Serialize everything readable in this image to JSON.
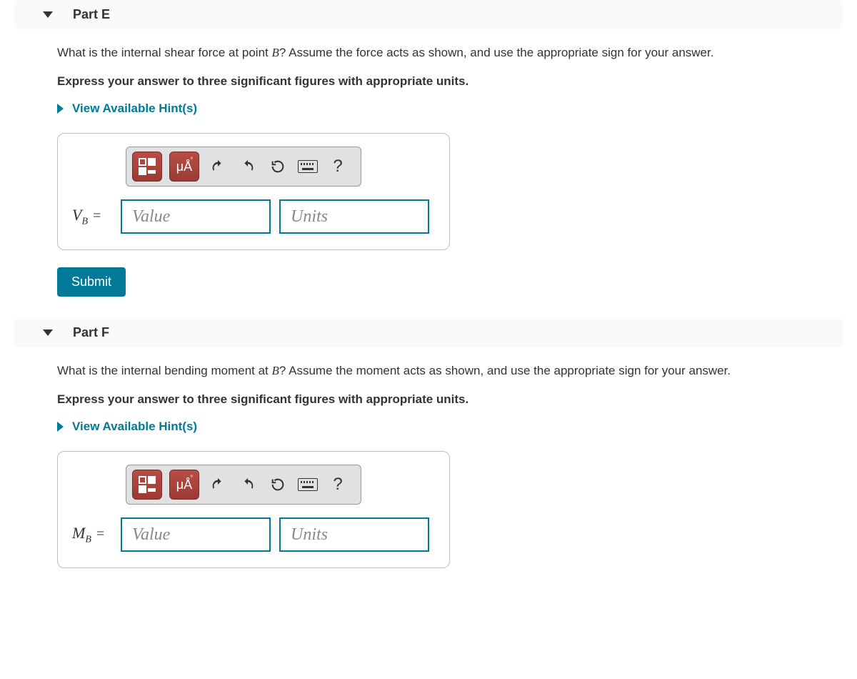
{
  "partE": {
    "title": "Part E",
    "prompt_before": "What is the internal shear force at point ",
    "prompt_var": "B",
    "prompt_after": "? Assume the force acts as shown, and use the appropriate sign for your answer.",
    "instruction": "Express your answer to three significant figures with appropriate units.",
    "hints_label": "View Available Hint(s)",
    "toolbar": {
      "special": "μÅ",
      "help": "?"
    },
    "var_symbol": "V",
    "var_sub": "B",
    "value_placeholder": "Value",
    "units_placeholder": "Units",
    "submit_label": "Submit"
  },
  "partF": {
    "title": "Part F",
    "prompt_before": "What is the internal bending moment at ",
    "prompt_var": "B",
    "prompt_after": "? Assume the moment acts as shown, and use the appropriate sign for your answer.",
    "instruction": "Express your answer to three significant figures with appropriate units.",
    "hints_label": "View Available Hint(s)",
    "toolbar": {
      "special": "μÅ",
      "help": "?"
    },
    "var_symbol": "M",
    "var_sub": "B",
    "value_placeholder": "Value",
    "units_placeholder": "Units"
  }
}
